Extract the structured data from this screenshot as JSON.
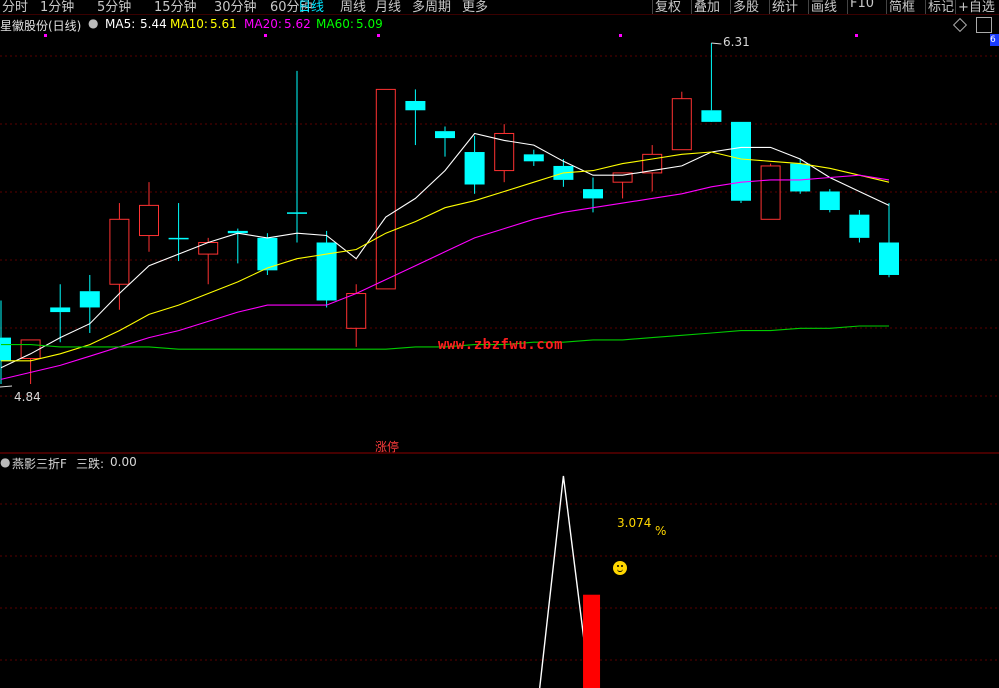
{
  "toolbar": {
    "left_tabs": [
      "分时",
      "1分钟",
      "5分钟",
      "15分钟",
      "30分钟",
      "60分钟",
      "日线",
      "周线",
      "月线",
      "多周期",
      "更多"
    ],
    "active_tab": "日线",
    "right_buttons": [
      "复权",
      "叠加",
      "多股",
      "统计",
      "画线",
      "F10",
      "简框",
      "标记",
      "+自选"
    ]
  },
  "stock_title": "星徽股份(日线)",
  "ma": {
    "ma5": {
      "label": "MA5:",
      "value": "5.44",
      "color": "#ffffff"
    },
    "ma10": {
      "label": "MA10:",
      "value": "5.61",
      "color": "#ffff00"
    },
    "ma20": {
      "label": "MA20:",
      "value": "5.62",
      "color": "#ff00ff"
    },
    "ma60": {
      "label": "MA60:",
      "value": "5.09",
      "color": "#00ff00"
    }
  },
  "chart": {
    "high_marker": "6.31",
    "low_marker": "4.84",
    "limit_up_tag": "涨停",
    "watermark": "www.zbzfwu.com",
    "right_tag": "6",
    "colors": {
      "up": "#ff3232",
      "down": "#00ffff",
      "ma5": "#ffffff",
      "ma10": "#ffff00",
      "ma20": "#ff00ff",
      "ma60": "#00cc00",
      "grid": "#5a0000"
    }
  },
  "indicator": {
    "name": "燕影三折F",
    "field_label": "三跌:",
    "field_value": "0.00",
    "pct_value": "3.074",
    "pct_unit": "%",
    "icon": "smiley-icon",
    "colors": {
      "line": "#ffffff",
      "bar": "#ff0000"
    }
  },
  "candles": [
    {
      "o": 5.04,
      "h": 5.2,
      "l": 4.84,
      "c": 4.94
    },
    {
      "o": 4.95,
      "h": 5.03,
      "l": 4.84,
      "c": 5.03
    },
    {
      "o": 5.17,
      "h": 5.27,
      "l": 5.02,
      "c": 5.15
    },
    {
      "o": 5.24,
      "h": 5.31,
      "l": 5.06,
      "c": 5.17
    },
    {
      "o": 5.27,
      "h": 5.62,
      "l": 5.16,
      "c": 5.55
    },
    {
      "o": 5.48,
      "h": 5.71,
      "l": 5.41,
      "c": 5.61
    },
    {
      "o": 5.47,
      "h": 5.62,
      "l": 5.37,
      "c": 5.47
    },
    {
      "o": 5.4,
      "h": 5.47,
      "l": 5.27,
      "c": 5.45
    },
    {
      "o": 5.5,
      "h": 5.51,
      "l": 5.36,
      "c": 5.49
    },
    {
      "o": 5.47,
      "h": 5.49,
      "l": 5.31,
      "c": 5.33
    },
    {
      "o": 5.58,
      "h": 6.19,
      "l": 5.45,
      "c": 5.58
    },
    {
      "o": 5.45,
      "h": 5.5,
      "l": 5.17,
      "c": 5.2
    },
    {
      "o": 5.08,
      "h": 5.27,
      "l": 5.0,
      "c": 5.23
    },
    {
      "o": 5.25,
      "h": 6.11,
      "l": 5.25,
      "c": 6.11
    },
    {
      "o": 6.06,
      "h": 6.11,
      "l": 5.87,
      "c": 6.02
    },
    {
      "o": 5.93,
      "h": 5.95,
      "l": 5.82,
      "c": 5.9
    },
    {
      "o": 5.84,
      "h": 5.91,
      "l": 5.66,
      "c": 5.7
    },
    {
      "o": 5.76,
      "h": 5.96,
      "l": 5.71,
      "c": 5.92
    },
    {
      "o": 5.83,
      "h": 5.85,
      "l": 5.78,
      "c": 5.8
    },
    {
      "o": 5.78,
      "h": 5.81,
      "l": 5.69,
      "c": 5.72
    },
    {
      "o": 5.68,
      "h": 5.73,
      "l": 5.58,
      "c": 5.64
    },
    {
      "o": 5.71,
      "h": 5.75,
      "l": 5.64,
      "c": 5.75
    },
    {
      "o": 5.75,
      "h": 5.87,
      "l": 5.67,
      "c": 5.83
    },
    {
      "o": 5.85,
      "h": 6.1,
      "l": 5.85,
      "c": 6.07
    },
    {
      "o": 6.02,
      "h": 6.31,
      "l": 5.99,
      "c": 5.97
    },
    {
      "o": 5.97,
      "h": 5.97,
      "l": 5.62,
      "c": 5.63
    },
    {
      "o": 5.55,
      "h": 5.79,
      "l": 5.55,
      "c": 5.78
    },
    {
      "o": 5.79,
      "h": 5.81,
      "l": 5.66,
      "c": 5.67
    },
    {
      "o": 5.67,
      "h": 5.68,
      "l": 5.58,
      "c": 5.59
    },
    {
      "o": 5.57,
      "h": 5.59,
      "l": 5.45,
      "c": 5.47
    },
    {
      "o": 5.45,
      "h": 5.62,
      "l": 5.3,
      "c": 5.31
    }
  ],
  "ma_series": {
    "ma5": [
      4.91,
      4.97,
      5.04,
      5.1,
      5.23,
      5.35,
      5.4,
      5.45,
      5.49,
      5.47,
      5.49,
      5.48,
      5.38,
      5.56,
      5.64,
      5.76,
      5.92,
      5.89,
      5.87,
      5.8,
      5.74,
      5.74,
      5.76,
      5.78,
      5.84,
      5.86,
      5.86,
      5.81,
      5.73,
      5.67,
      5.61
    ],
    "ma10": [
      4.94,
      4.94,
      4.97,
      5.01,
      5.07,
      5.14,
      5.18,
      5.23,
      5.28,
      5.34,
      5.38,
      5.4,
      5.42,
      5.49,
      5.54,
      5.6,
      5.63,
      5.67,
      5.71,
      5.75,
      5.76,
      5.79,
      5.81,
      5.83,
      5.84,
      5.81,
      5.8,
      5.79,
      5.77,
      5.74,
      5.71
    ],
    "ma20": [
      4.86,
      4.89,
      4.92,
      4.96,
      5.0,
      5.04,
      5.07,
      5.11,
      5.15,
      5.18,
      5.18,
      5.18,
      5.23,
      5.29,
      5.35,
      5.41,
      5.47,
      5.51,
      5.55,
      5.58,
      5.6,
      5.62,
      5.64,
      5.66,
      5.69,
      5.71,
      5.72,
      5.72,
      5.73,
      5.74,
      5.72
    ],
    "ma60": [
      5.01,
      5.01,
      5.0,
      5.0,
      5.0,
      5.0,
      4.99,
      4.99,
      4.99,
      4.99,
      4.99,
      4.99,
      4.99,
      4.99,
      5.0,
      5.0,
      5.01,
      5.01,
      5.02,
      5.02,
      5.03,
      5.03,
      5.04,
      5.05,
      5.06,
      5.07,
      5.07,
      5.08,
      5.08,
      5.09,
      5.09
    ]
  },
  "indicator_data": {
    "line": [
      {
        "i": 18.2,
        "v": 0.0
      },
      {
        "i": 19.0,
        "v": 1.0
      },
      {
        "i": 19.9,
        "v": 0.0
      }
    ],
    "bar": {
      "i": 19.9,
      "v": 0.44
    }
  }
}
